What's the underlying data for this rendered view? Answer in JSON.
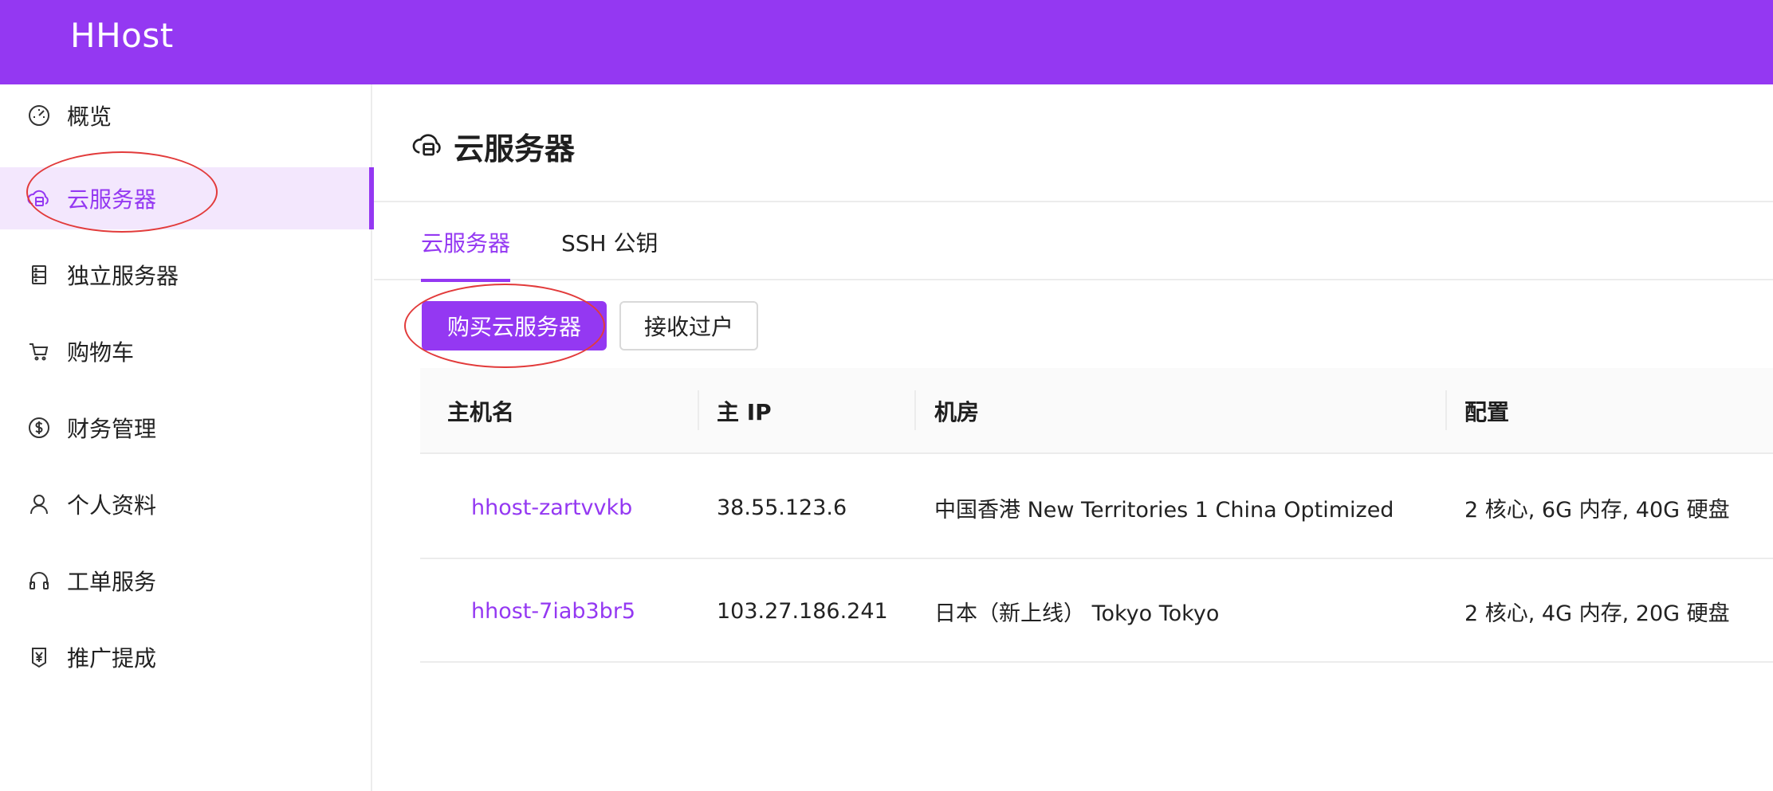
{
  "app": {
    "brand": "HHost"
  },
  "sidebar": {
    "items": [
      {
        "label": "概览",
        "icon": "dashboard-gauge-icon",
        "active": false
      },
      {
        "label": "云服务器",
        "icon": "cloud-server-icon",
        "active": true
      },
      {
        "label": "独立服务器",
        "icon": "server-rack-icon",
        "active": false
      },
      {
        "label": "购物车",
        "icon": "shopping-cart-icon",
        "active": false
      },
      {
        "label": "财务管理",
        "icon": "dollar-circle-icon",
        "active": false
      },
      {
        "label": "个人资料",
        "icon": "user-icon",
        "active": false
      },
      {
        "label": "工单服务",
        "icon": "headset-icon",
        "active": false
      },
      {
        "label": "推广提成",
        "icon": "yen-badge-icon",
        "active": false
      }
    ]
  },
  "page": {
    "title": "云服务器",
    "title_icon": "cloud-server-icon"
  },
  "tabs": [
    {
      "label": "云服务器",
      "active": true
    },
    {
      "label": "SSH 公钥",
      "active": false
    }
  ],
  "actions": {
    "buy_label": "购买云服务器",
    "transfer_label": "接收过户"
  },
  "table": {
    "columns": [
      "主机名",
      "主 IP",
      "机房",
      "配置"
    ],
    "rows": [
      {
        "hostname": "hhost-zartvvkb",
        "ip": "38.55.123.6",
        "datacenter": "中国香港 New Territories 1 China Optimized",
        "config": "2 核心, 6G 内存, 40G 硬盘"
      },
      {
        "hostname": "hhost-7iab3br5",
        "ip": "103.27.186.241",
        "datacenter": "日本（新上线） Tokyo Tokyo",
        "config": "2 核心, 4G 内存, 20G 硬盘"
      }
    ]
  },
  "colors": {
    "brand": "#9438f2",
    "active_bg": "#f3e7fd",
    "annotation": "#e23b3b"
  }
}
